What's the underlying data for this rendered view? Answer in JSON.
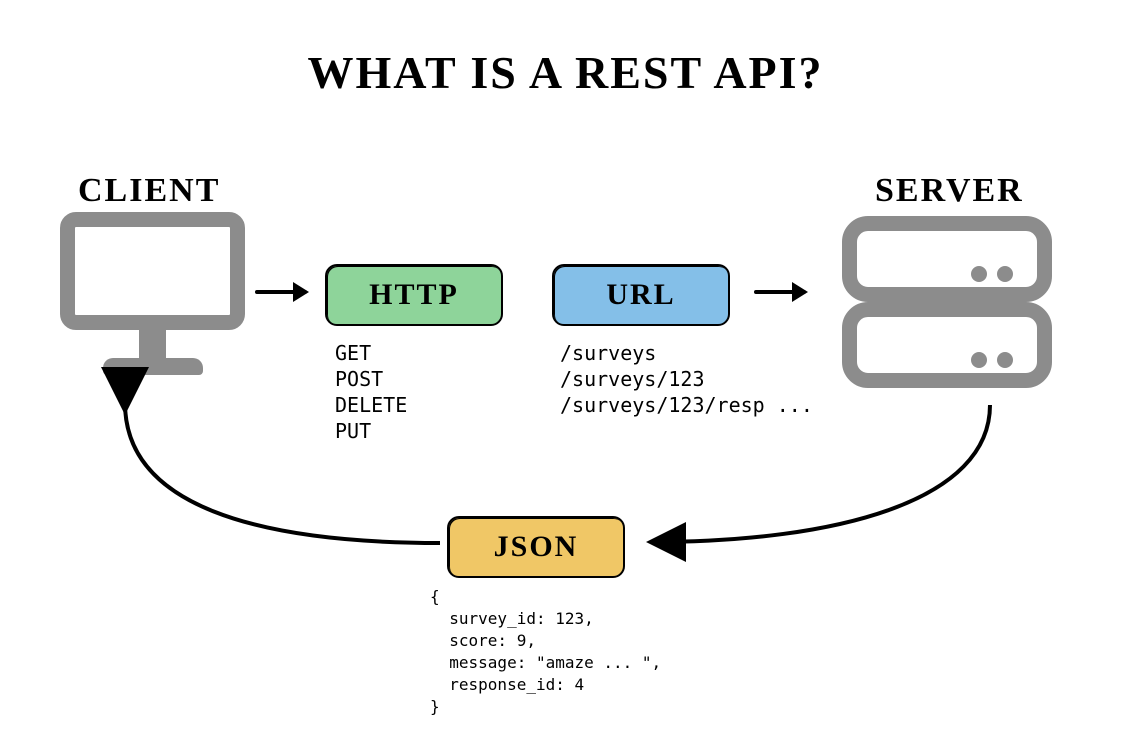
{
  "title": "WHAT IS A REST API?",
  "client": {
    "label": "CLIENT"
  },
  "server": {
    "label": "SERVER"
  },
  "http": {
    "label": "HTTP",
    "methods": [
      "GET",
      "POST",
      "DELETE",
      "PUT"
    ]
  },
  "url": {
    "label": "URL",
    "paths": [
      "/surveys",
      "/surveys/123",
      "/surveys/123/resp ..."
    ]
  },
  "json": {
    "label": "JSON",
    "body_lines": [
      "{",
      "  survey_id: 123,",
      "  score: 9,",
      "  message: \"amaze ... \",",
      "  response_id: 4",
      "}"
    ]
  },
  "colors": {
    "http_fill": "#8ed49a",
    "url_fill": "#84bfe8",
    "json_fill": "#f0c766",
    "icon_grey": "#8c8c8c"
  }
}
